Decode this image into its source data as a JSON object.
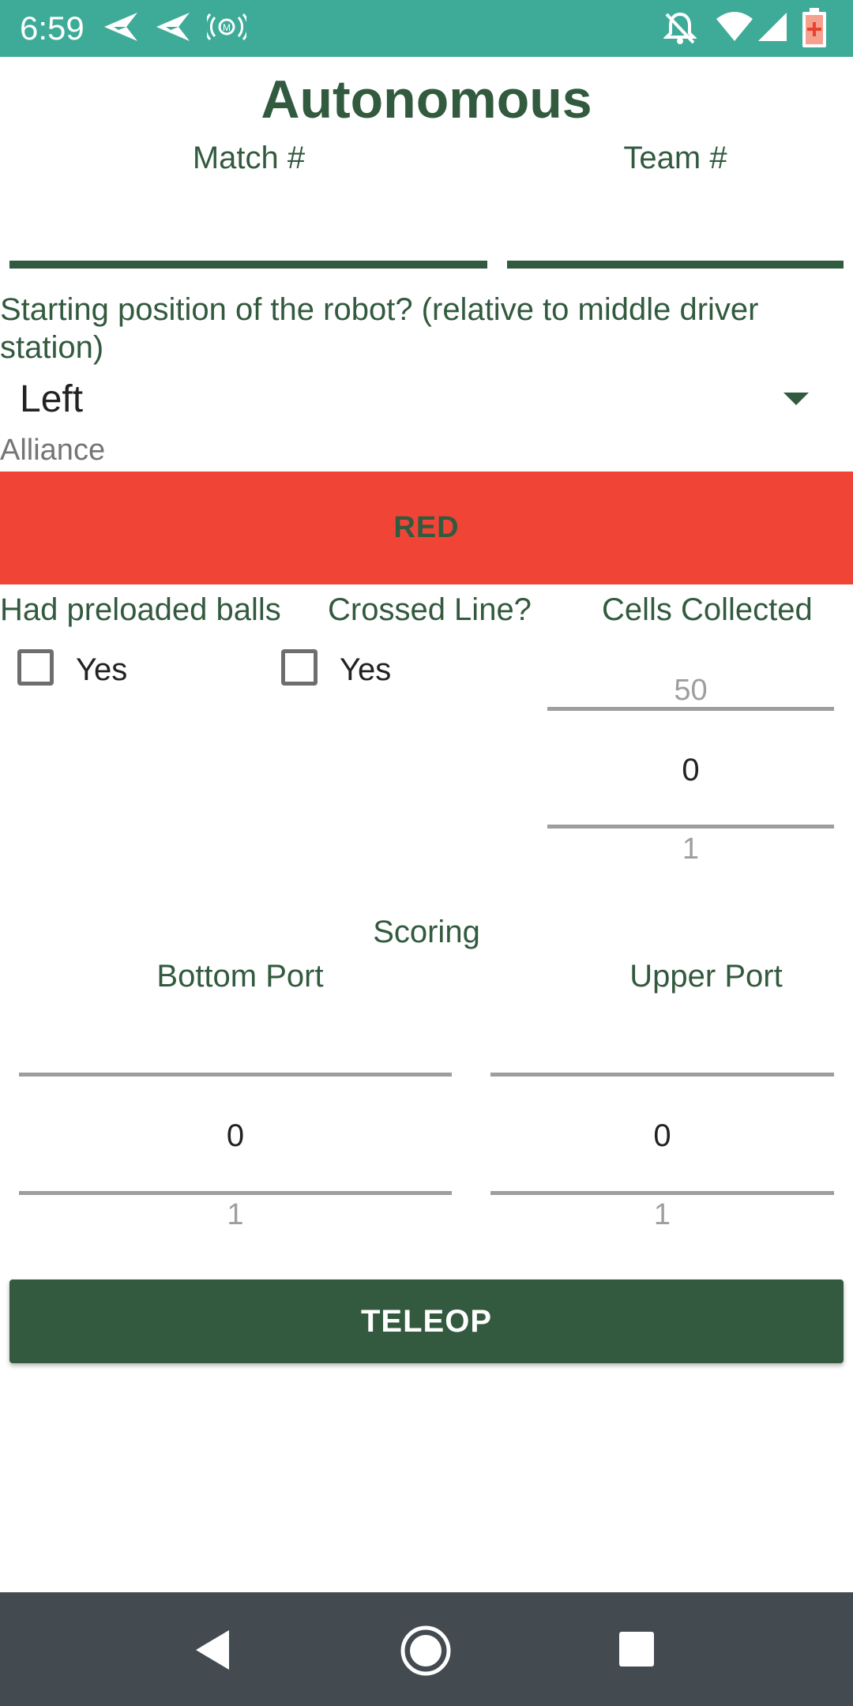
{
  "status_bar": {
    "time": "6:59",
    "color": "#3dab98",
    "icons": [
      "send-icon",
      "send-icon",
      "broadcast-icon",
      "notifications-off-icon",
      "wifi-icon",
      "cell-signal-icon",
      "battery-icon"
    ]
  },
  "header": {
    "title": "Autonomous"
  },
  "inputs": {
    "match_label": "Match #",
    "team_label": "Team #",
    "match_value": "",
    "team_value": ""
  },
  "starting_position": {
    "question": "Starting position of the robot? (relative to middle driver station)",
    "selected": "Left"
  },
  "alliance": {
    "label": "Alliance",
    "button_label": "RED",
    "button_color": "#f04437"
  },
  "preloaded": {
    "label": "Had preloaded balls",
    "checkbox_label": "Yes",
    "checked": false
  },
  "crossed_line": {
    "label": "Crossed Line?",
    "checkbox_label": "Yes",
    "checked": false
  },
  "cells_collected": {
    "label": "Cells Collected",
    "prev": "50",
    "value": "0",
    "next": "1"
  },
  "scoring": {
    "label": "Scoring",
    "bottom_port": {
      "label": "Bottom Port",
      "prev": "",
      "value": "0",
      "next": "1"
    },
    "upper_port": {
      "label": "Upper Port",
      "prev": "",
      "value": "0",
      "next": "1"
    }
  },
  "teleop_button": {
    "label": "TELEOP",
    "color": "#335a3e"
  },
  "nav_bar": {
    "buttons": [
      "back-icon",
      "home-icon",
      "recents-icon"
    ]
  }
}
